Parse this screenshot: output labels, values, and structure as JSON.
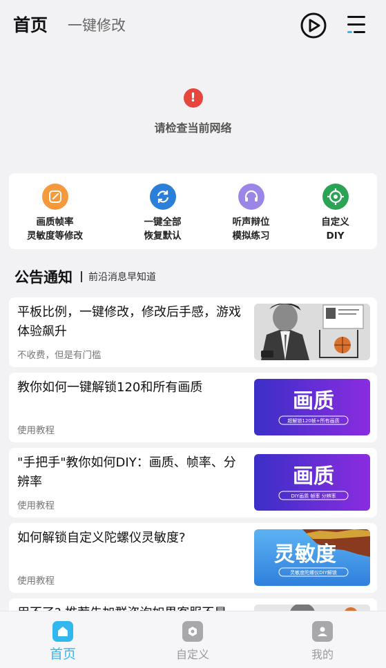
{
  "header": {
    "title": "首页",
    "subtitle": "一键修改",
    "play_icon": "play-circle-icon",
    "menu_icon": "menu-icon"
  },
  "error": {
    "icon": "alert-icon",
    "mark": "!",
    "message": "请检查当前网络",
    "color": "#e8453c"
  },
  "quick_actions": [
    {
      "icon": "edit-icon",
      "color": "#f59a3c",
      "line1": "画质帧率",
      "line2": "灵敏度等修改"
    },
    {
      "icon": "refresh-icon",
      "color": "#2b7fd9",
      "line1": "一键全部",
      "line2": "恢复默认"
    },
    {
      "icon": "headset-icon",
      "color": "#9b86e8",
      "line1": "听声辩位",
      "line2": "模拟练习"
    },
    {
      "icon": "crosshair-icon",
      "color": "#2aa354",
      "line1": "自定义",
      "line2": "DIY"
    }
  ],
  "notice": {
    "title": "公告通知",
    "subtitle": "前沿消息早知道"
  },
  "articles": [
    {
      "title": "平板比例，一键修改，修改后手感，游戏体验飙升",
      "meta": "不收费，但是有门槛",
      "thumb": {
        "kind": "photo"
      }
    },
    {
      "title": "教你如何一键解锁120和所有画质",
      "meta": "使用教程",
      "thumb": {
        "kind": "banner",
        "big": "画质",
        "small": "超解锁120帧+所有画质"
      }
    },
    {
      "title": "\"手把手\"教你如何DIY：画质、帧率、分辨率",
      "meta": "使用教程",
      "thumb": {
        "kind": "banner",
        "big": "画质",
        "small": "DIY画质  帧率  分辨率"
      }
    },
    {
      "title": "如何解锁自定义陀螺仪灵敏度?",
      "meta": "使用教程",
      "thumb": {
        "kind": "sky",
        "big": "灵敏度",
        "small": "灵敏度陀螺仪DIY解锁"
      }
    },
    {
      "title": "用不了? 推荐先加群咨询如果客服不是",
      "meta": "",
      "thumb": {
        "kind": "photo"
      }
    }
  ],
  "tabs": [
    {
      "label": "首页",
      "icon": "home-icon",
      "active": true
    },
    {
      "label": "自定义",
      "icon": "customize-icon",
      "active": false
    },
    {
      "label": "我的",
      "icon": "profile-icon",
      "active": false
    }
  ],
  "colors": {
    "accent": "#33b7ef",
    "background": "#f2f2f4",
    "banner_purple": "#5a2bd6"
  }
}
